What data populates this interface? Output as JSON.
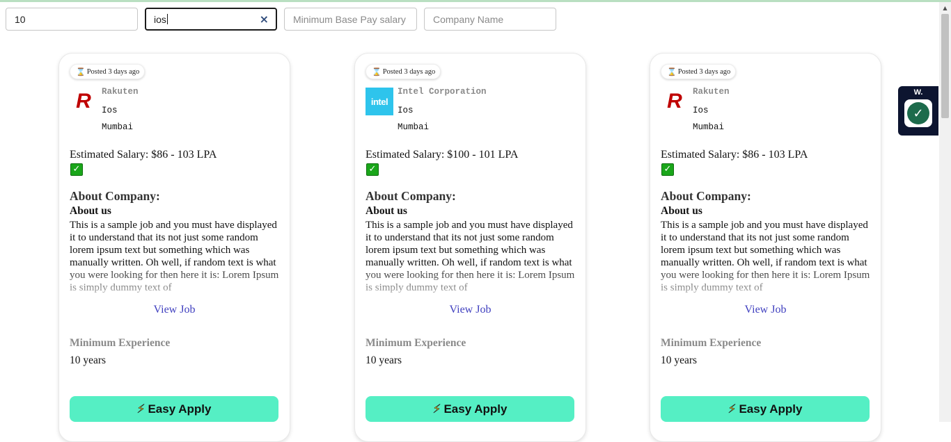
{
  "filters": {
    "experience_value": "10",
    "role_value": "ios",
    "min_pay_placeholder": "Minimum Base Pay salary",
    "company_placeholder": "Company Name",
    "clear_glyph": "×"
  },
  "cards": [
    {
      "posted": "Posted 3 days ago",
      "logo_text": "R",
      "company": "Rakuten",
      "role": "Ios",
      "location": "Mumbai",
      "salary": "Estimated Salary: $86 - 103 LPA",
      "check_glyph": "✓",
      "about_heading": "About Company:",
      "about_subheading": "About us",
      "about_text": "This is a sample job and you must have displayed it to understand that its not just some random lorem ipsum text but something which was manually written. Oh well, if random text is what you were looking for then here it is: Lorem Ipsum is simply dummy text of",
      "view_job": "View Job",
      "min_exp_heading": "Minimum Experience",
      "min_exp_value": "10 years",
      "apply_label": "Easy Apply"
    },
    {
      "posted": "Posted 3 days ago",
      "logo_text": "intel",
      "company": "Intel Corporation",
      "role": "Ios",
      "location": "Mumbai",
      "salary": "Estimated Salary: $100 - 101 LPA",
      "check_glyph": "✓",
      "about_heading": "About Company:",
      "about_subheading": "About us",
      "about_text": "This is a sample job and you must have displayed it to understand that its not just some random lorem ipsum text but something which was manually written. Oh well, if random text is what you were looking for then here it is: Lorem Ipsum is simply dummy text of",
      "view_job": "View Job",
      "min_exp_heading": "Minimum Experience",
      "min_exp_value": "10 years",
      "apply_label": "Easy Apply"
    },
    {
      "posted": "Posted 3 days ago",
      "logo_text": "R",
      "company": "Rakuten",
      "role": "Ios",
      "location": "Mumbai",
      "salary": "Estimated Salary: $86 - 103 LPA",
      "check_glyph": "✓",
      "about_heading": "About Company:",
      "about_subheading": "About us",
      "about_text": "This is a sample job and you must have displayed it to understand that its not just some random lorem ipsum text but something which was manually written. Oh well, if random text is what you were looking for then here it is: Lorem Ipsum is simply dummy text of",
      "view_job": "View Job",
      "min_exp_heading": "Minimum Experience",
      "min_exp_value": "10 years",
      "apply_label": "Easy Apply"
    }
  ],
  "icons": {
    "posted": "hourglass-icon",
    "apply": "lightning-bolt-icon",
    "hourglass_glyph": "⌛",
    "bolt_glyph": "⚡"
  },
  "widget": {
    "label": "W.",
    "check_glyph": "✓",
    "accent": "#1d6b4c"
  },
  "colors": {
    "apply_button": "#55efc4",
    "view_job_link": "#3f3fbf"
  }
}
